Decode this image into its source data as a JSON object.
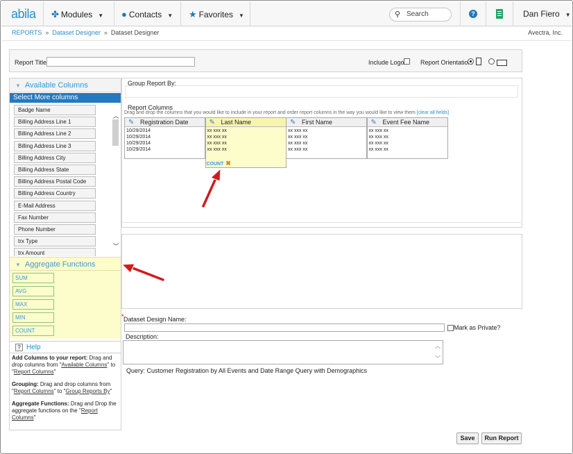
{
  "topbar": {
    "logo": "abila",
    "modules": "Modules",
    "contacts": "Contacts",
    "favorites": "Favorites",
    "search_label": "Search",
    "help": "?",
    "user": "Dan Fiero"
  },
  "breadcrumb": {
    "items": [
      "REPORTS",
      "Dataset Designer",
      "Dataset Designer"
    ],
    "sep": "»"
  },
  "company": "Avectra, Inc.",
  "report": {
    "title_label": "Report Title:",
    "include_logo_label": "Include Logo?",
    "orientation_label": "Report Orientation:"
  },
  "left": {
    "available_columns": "Available Columns",
    "select_more": "Select More columns",
    "columns": [
      "Badge Name",
      "Billing Address Line 1",
      "Billing Address Line 2",
      "Billing Address Line 3",
      "Billing Address City",
      "Billing Address State",
      "Billing Address Postal Code",
      "Billing Address Country",
      "E-Mail Address",
      "Fax Number",
      "Phone Number",
      "trx Type",
      "trx Amount"
    ],
    "aggregate_functions": "Aggregate Functions",
    "aggregates": [
      "SUM",
      "AVG",
      "MAX",
      "MIN",
      "COUNT"
    ],
    "help_title": "Help",
    "help": {
      "p1_bold": "Add Columns to your report:",
      "p1_a": " Drag and drop columns from \"",
      "p1_link1": "Available Columns",
      "p1_b": "\" to \"",
      "p1_link2": "Report Columns",
      "p1_c": "\"",
      "p2_bold": "Grouping:",
      "p2_a": " Drag and drop columns from \"",
      "p2_link1": "Report Columns",
      "p2_b": "\" to \"",
      "p2_link2": "Group Reports By",
      "p2_c": "\"",
      "p3_bold": "Aggregate Functions:",
      "p3_a": " Drag and Drop the aggregate functions on the \"",
      "p3_link1": "Report Columns",
      "p3_c": "\""
    }
  },
  "main": {
    "group_by_label": "Group Report By:",
    "report_columns_label": "Report Columns",
    "hint": "Drag and drop the columns that you would like to include in your report and order report columns in the way you would like to view them",
    "clear_all": "[clear all fields]",
    "columns": [
      {
        "name": "Registration Date",
        "rows": [
          "10/29/2014",
          "10/29/2014",
          "10/29/2014",
          "10/29/2014"
        ]
      },
      {
        "name": "Last Name",
        "rows": [
          "xx xxx xx",
          "xx xxx xx",
          "xx xxx xx",
          "xx xxx xx"
        ],
        "aggregate": "COUNT"
      },
      {
        "name": "First Name",
        "rows": [
          "xx xxx xx",
          "xx xxx xx",
          "xx xxx xx",
          "xx xxx xx"
        ]
      },
      {
        "name": "Event Fee Name",
        "rows": [
          "xx xxx xx",
          "xx xxx xx",
          "xx xxx xx",
          "xx xxx xx"
        ]
      }
    ]
  },
  "form": {
    "dataset_name_label": "Dataset Design Name:",
    "mark_private": "Mark as Private?",
    "description_label": "Description:",
    "query": "Query: Customer Registration by All Events and Date Range Query with Demographics"
  },
  "buttons": {
    "save": "Save",
    "run_report": "Run Report"
  },
  "colors": {
    "accent": "#2679be",
    "highlight": "#fdfccb",
    "arrow": "#d11b1b"
  }
}
